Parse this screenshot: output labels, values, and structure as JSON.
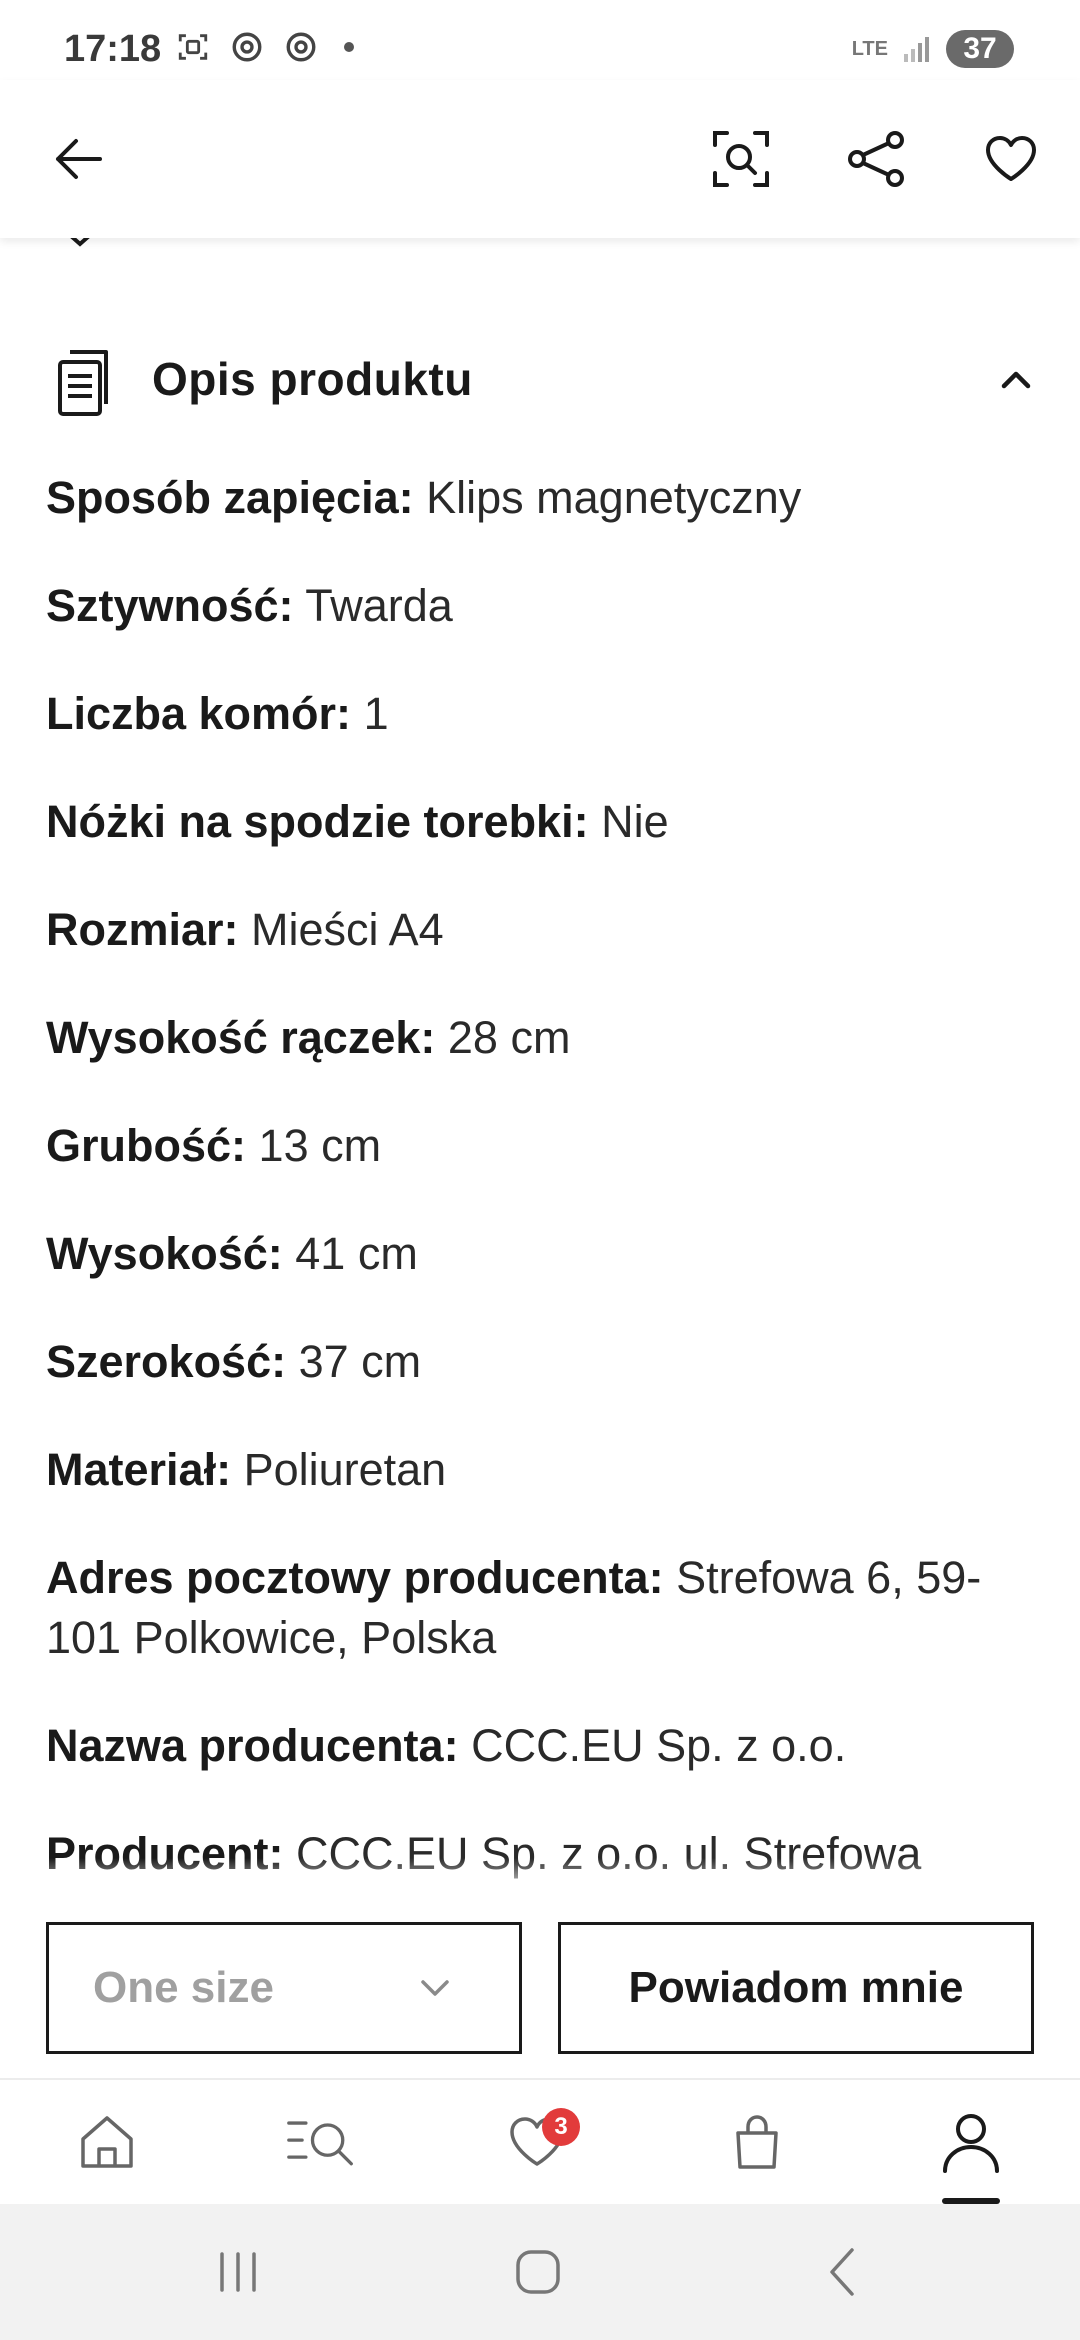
{
  "status_bar": {
    "time": "17:18",
    "network": "LTE",
    "battery": "37"
  },
  "app_bar": {
    "back_icon": "arrow-left-icon",
    "scan_icon": "visual-search-icon",
    "share_icon": "share-icon",
    "favorite_icon": "heart-icon"
  },
  "section": {
    "title": "Opis produktu",
    "expanded": true
  },
  "specs": [
    {
      "key": "Sposób zapięcia:",
      "value": "Klips magnetyczny"
    },
    {
      "key": "Sztywność:",
      "value": "Twarda"
    },
    {
      "key": "Liczba komór:",
      "value": "1"
    },
    {
      "key": "Nóżki na spodzie torebki:",
      "value": "Nie"
    },
    {
      "key": "Rozmiar:",
      "value": "Mieści A4"
    },
    {
      "key": "Wysokość rączek:",
      "value": "28 cm"
    },
    {
      "key": "Grubość:",
      "value": "13 cm"
    },
    {
      "key": "Wysokość:",
      "value": "41 cm"
    },
    {
      "key": "Szerokość:",
      "value": "37 cm"
    },
    {
      "key": "Materiał:",
      "value": "Poliuretan"
    },
    {
      "key": "Adres pocztowy producenta:",
      "value": "Strefowa 6, 59-101 Polkowice, Polska"
    },
    {
      "key": "Nazwa producenta:",
      "value": "CCC.EU Sp. z o.o."
    },
    {
      "key": "Producent:",
      "value": "CCC.EU Sp. z o.o.  ul. Strefowa"
    }
  ],
  "actions": {
    "size_select": "One size",
    "notify_button": "Powiadom mnie"
  },
  "bottom_nav": {
    "favorites_badge": "3",
    "active": "account"
  },
  "colors": {
    "badge": "#e23b3b",
    "text": "#1a1a1a",
    "muted": "#a0a0a0"
  }
}
